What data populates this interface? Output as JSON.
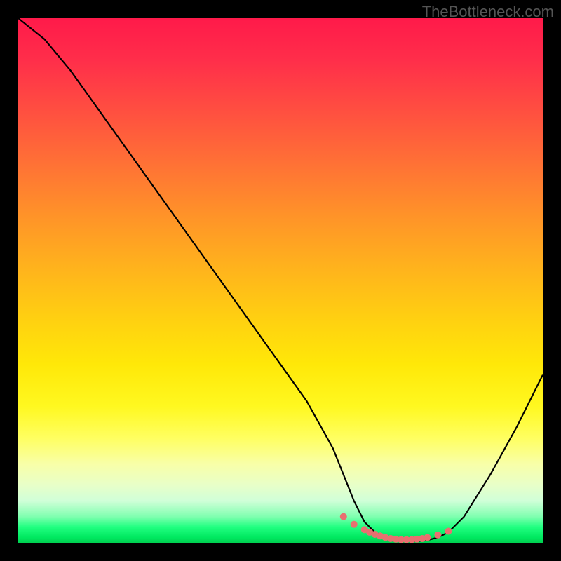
{
  "watermark": "TheBottleneck.com",
  "chart_data": {
    "type": "line",
    "title": "",
    "xlabel": "",
    "ylabel": "",
    "xlim": [
      0,
      100
    ],
    "ylim": [
      0,
      100
    ],
    "grid": false,
    "legend": false,
    "series": [
      {
        "name": "curve",
        "x": [
          0,
          5,
          10,
          15,
          20,
          25,
          30,
          35,
          40,
          45,
          50,
          55,
          60,
          62,
          64,
          66,
          68,
          70,
          72,
          74,
          76,
          78,
          80,
          82,
          85,
          90,
          95,
          100
        ],
        "y": [
          100,
          96,
          90,
          83,
          76,
          69,
          62,
          55,
          48,
          41,
          34,
          27,
          18,
          13,
          8,
          4,
          2,
          1,
          0.5,
          0.3,
          0.3,
          0.5,
          1,
          2,
          5,
          13,
          22,
          32
        ]
      }
    ],
    "highlight_points": {
      "name": "optimal-band",
      "x": [
        62,
        64,
        66,
        67,
        68,
        69,
        70,
        71,
        72,
        73,
        74,
        75,
        76,
        77,
        78,
        80,
        82
      ],
      "y": [
        5,
        3.5,
        2.5,
        2,
        1.6,
        1.3,
        1,
        0.8,
        0.7,
        0.6,
        0.6,
        0.6,
        0.7,
        0.8,
        1,
        1.5,
        2.2
      ]
    },
    "background_gradient": {
      "orientation": "vertical",
      "stops": [
        {
          "pos": 0.0,
          "color": "#ff1a4a"
        },
        {
          "pos": 0.5,
          "color": "#ffc010"
        },
        {
          "pos": 0.8,
          "color": "#ffff60"
        },
        {
          "pos": 0.95,
          "color": "#80ffb0"
        },
        {
          "pos": 1.0,
          "color": "#00d050"
        }
      ]
    }
  }
}
